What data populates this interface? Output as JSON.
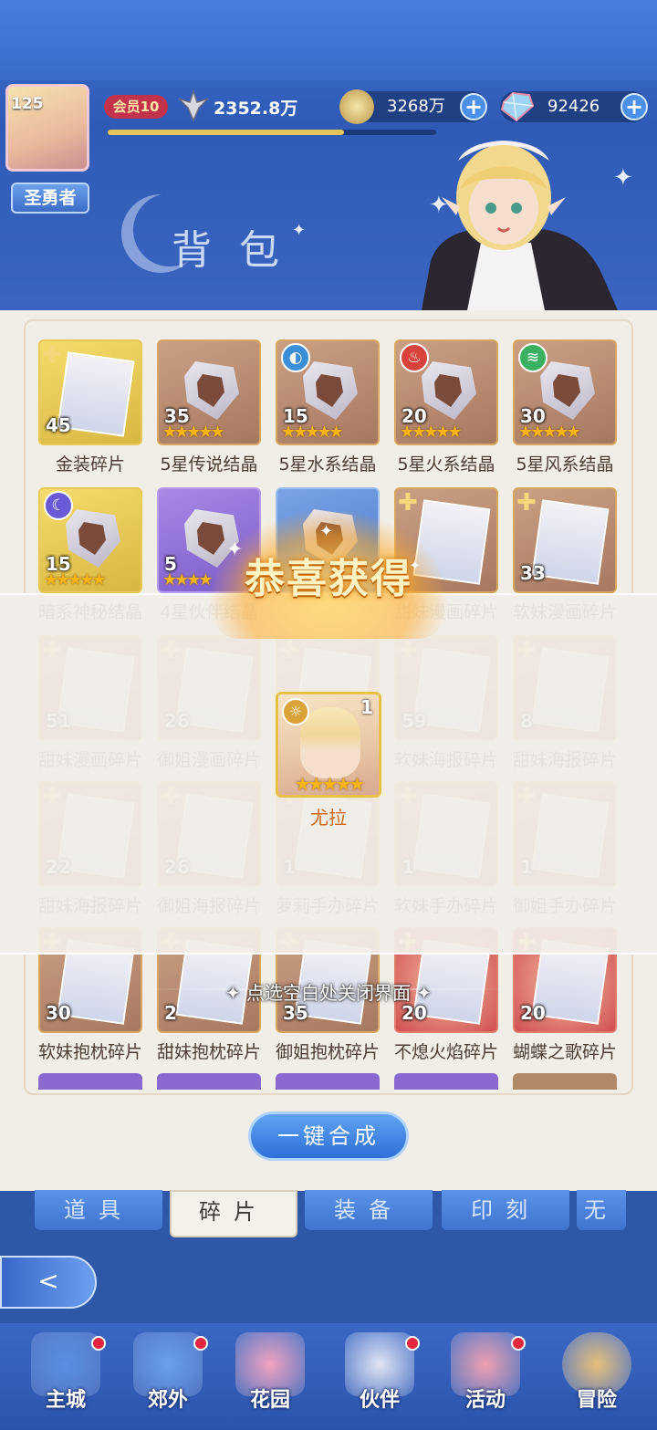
{
  "header": {
    "level": "125",
    "title_badge": "圣勇者",
    "vip": "会员10",
    "power": "2352.8万",
    "gold": "3268万",
    "gems": "92426",
    "plus": "+",
    "page_title": "背包",
    "exp_progress": 0.72
  },
  "items": [
    {
      "label": "金装碎片",
      "count": "45",
      "style": "gold",
      "kind": "puzzle",
      "stars": ""
    },
    {
      "label": "5星传说结晶",
      "count": "35",
      "style": "brown",
      "kind": "crystal",
      "stars": "★★★★★"
    },
    {
      "label": "5星水系结晶",
      "count": "15",
      "style": "brown",
      "kind": "crystal",
      "stars": "★★★★★",
      "elem_color": "#3a8fd8",
      "elem": "◐"
    },
    {
      "label": "5星火系结晶",
      "count": "20",
      "style": "brown",
      "kind": "crystal",
      "stars": "★★★★★",
      "elem_color": "#d8423a",
      "elem": "♨"
    },
    {
      "label": "5星风系结晶",
      "count": "30",
      "style": "brown",
      "kind": "crystal",
      "stars": "★★★★★",
      "elem_color": "#3ab060",
      "elem": "≋"
    },
    {
      "label": "暗系神秘结晶",
      "count": "15",
      "style": "gold",
      "kind": "crystal",
      "stars": "★★★★★",
      "elem_color": "#6a5ad8",
      "elem": "☾"
    },
    {
      "label": "4星伙伴结晶",
      "count": "5",
      "style": "purple",
      "kind": "crystal",
      "stars": "★★★★"
    },
    {
      "label": "",
      "count": "",
      "style": "blue",
      "kind": "crystal",
      "stars": ""
    },
    {
      "label": "甜妹漫画碎片",
      "count": "",
      "style": "brown",
      "kind": "pic",
      "stars": ""
    },
    {
      "label": "软妹漫画碎片",
      "count": "33",
      "style": "brown",
      "kind": "pic",
      "stars": ""
    },
    {
      "label": "甜妹漫画碎片",
      "count": "51",
      "style": "brown",
      "kind": "pic",
      "stars": ""
    },
    {
      "label": "御姐漫画碎片",
      "count": "26",
      "style": "brown",
      "kind": "pic",
      "stars": ""
    },
    {
      "label": "",
      "count": "",
      "style": "brown",
      "kind": "pic",
      "stars": ""
    },
    {
      "label": "软妹海报碎片",
      "count": "59",
      "style": "brown",
      "kind": "pic",
      "stars": ""
    },
    {
      "label": "甜妹海报碎片",
      "count": "8",
      "style": "brown",
      "kind": "pic",
      "stars": ""
    },
    {
      "label": "甜妹海报碎片",
      "count": "22",
      "style": "brown",
      "kind": "pic",
      "stars": ""
    },
    {
      "label": "御姐海报碎片",
      "count": "26",
      "style": "brown",
      "kind": "pic",
      "stars": ""
    },
    {
      "label": "萝莉手办碎片",
      "count": "1",
      "style": "brown",
      "kind": "pic",
      "stars": ""
    },
    {
      "label": "软妹手办碎片",
      "count": "1",
      "style": "brown",
      "kind": "pic",
      "stars": ""
    },
    {
      "label": "御姐手办碎片",
      "count": "1",
      "style": "brown",
      "kind": "pic",
      "stars": ""
    },
    {
      "label": "软妹抱枕碎片",
      "count": "30",
      "style": "brown",
      "kind": "pic",
      "stars": ""
    },
    {
      "label": "甜妹抱枕碎片",
      "count": "2",
      "style": "brown",
      "kind": "pic",
      "stars": ""
    },
    {
      "label": "御姐抱枕碎片",
      "count": "35",
      "style": "brown",
      "kind": "pic",
      "stars": ""
    },
    {
      "label": "不熄火焰碎片",
      "count": "20",
      "style": "red",
      "kind": "pic",
      "stars": ""
    },
    {
      "label": "蝴蝶之歌碎片",
      "count": "20",
      "style": "red",
      "kind": "pic",
      "stars": ""
    }
  ],
  "compose_button": "一键合成",
  "tabs": [
    "道具",
    "碎片",
    "装备",
    "印刻",
    "无"
  ],
  "back_label": "<",
  "nav": [
    {
      "label": "主城",
      "icon": "castle-icon",
      "dot": true
    },
    {
      "label": "郊外",
      "icon": "portal-icon",
      "dot": true
    },
    {
      "label": "花园",
      "icon": "heart-icon",
      "dot": false
    },
    {
      "label": "伙伴",
      "icon": "partner-icon",
      "dot": true
    },
    {
      "label": "活动",
      "icon": "gift-icon",
      "dot": true
    },
    {
      "label": "冒险",
      "icon": "compass-icon",
      "dot": false
    }
  ],
  "modal": {
    "title": "恭喜获得",
    "reward_name": "尤拉",
    "reward_count": "1",
    "reward_stars": "★★★★★",
    "reward_elem": "☼",
    "close_hint": "点选空白处关闭界面"
  },
  "colors": {
    "accent": "#3f73d0",
    "gold": "#e8c248",
    "name": "#d26a15"
  }
}
